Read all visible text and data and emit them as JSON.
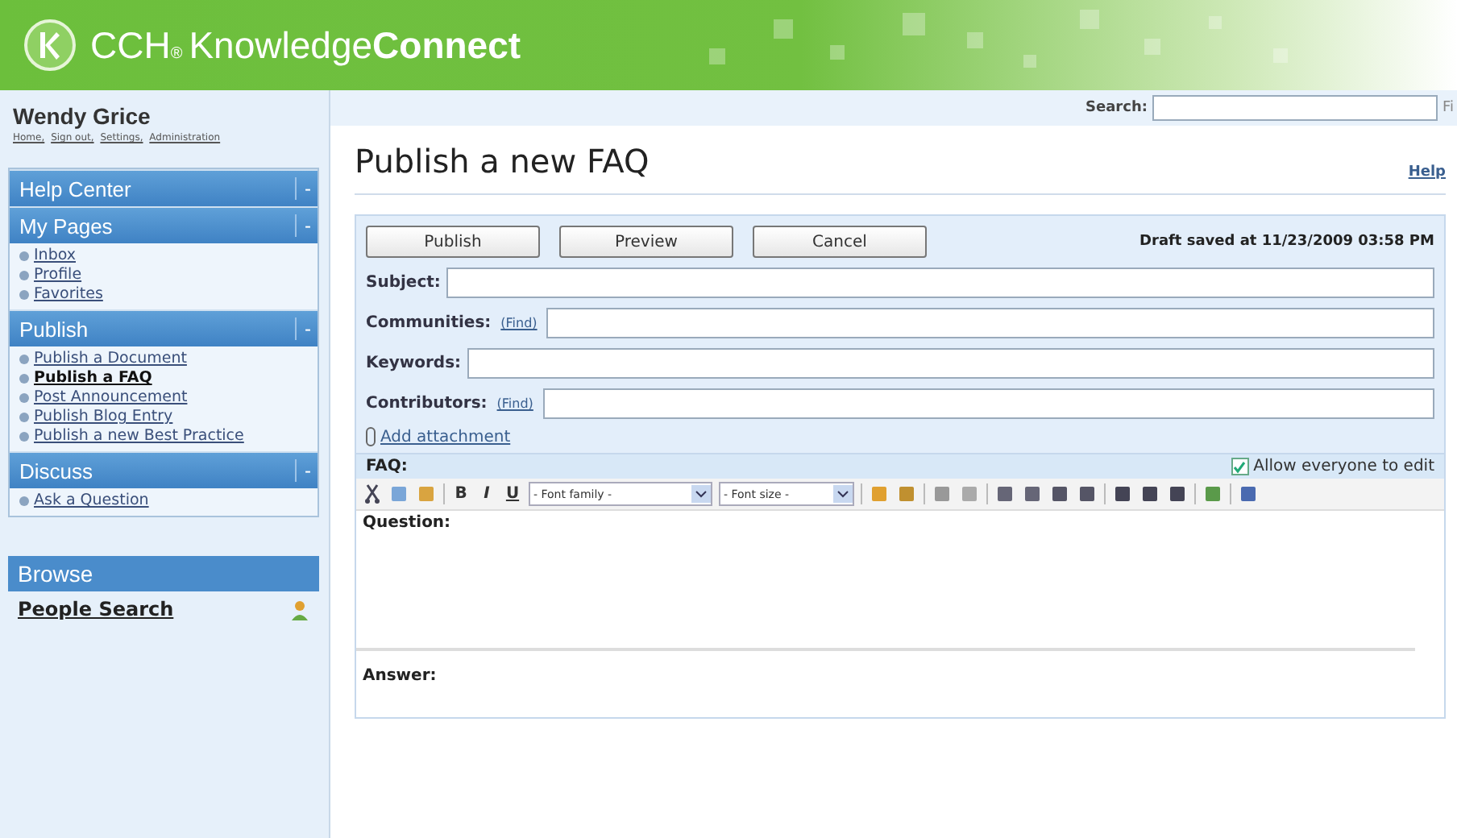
{
  "header": {
    "brand": "CCH",
    "brand_mark": "®",
    "product_light": "Knowledge",
    "product_bold": "Connect"
  },
  "user": {
    "name": "Wendy Grice",
    "links": [
      "Home,",
      "Sign out,",
      "Settings,",
      "Administration"
    ]
  },
  "search": {
    "label": "Search:",
    "button": "Fi"
  },
  "sidebar": {
    "sections": [
      {
        "title": "Help Center",
        "toggle": "-"
      },
      {
        "title": "My Pages",
        "toggle": "-",
        "items": [
          {
            "label": "Inbox",
            "selected": false
          },
          {
            "label": "Profile",
            "selected": false
          },
          {
            "label": "Favorites",
            "selected": false
          }
        ]
      },
      {
        "title": "Publish",
        "toggle": "-",
        "items": [
          {
            "label": "Publish a Document",
            "selected": false
          },
          {
            "label": "Publish a FAQ",
            "selected": true
          },
          {
            "label": "Post Announcement",
            "selected": false
          },
          {
            "label": "Publish Blog Entry",
            "selected": false
          },
          {
            "label": "Publish a new Best Practice",
            "selected": false
          }
        ]
      },
      {
        "title": "Discuss",
        "toggle": "-",
        "items": [
          {
            "label": "Ask a Question",
            "selected": false
          }
        ]
      }
    ],
    "browse": {
      "title": "Browse",
      "link": "People Search"
    }
  },
  "page": {
    "title": "Publish a new FAQ",
    "help": "Help"
  },
  "form": {
    "buttons": [
      "Publish",
      "Preview",
      "Cancel"
    ],
    "draft_status": "Draft saved at 11/23/2009 03:58 PM",
    "fields": [
      {
        "label": "Subject:"
      },
      {
        "label": "Communities:",
        "find": "(Find)"
      },
      {
        "label": "Keywords:"
      },
      {
        "label": "Contributors:",
        "find": "(Find)"
      }
    ],
    "attachment": "Add attachment"
  },
  "editor": {
    "label": "FAQ:",
    "allow_edit": {
      "label": "Allow everyone to edit",
      "checked": true
    },
    "format_buttons": [
      "B",
      "I",
      "U"
    ],
    "font_family": "- Font family -",
    "font_size": "- Font size -",
    "question_label": "Question:",
    "answer_label": "Answer:"
  }
}
